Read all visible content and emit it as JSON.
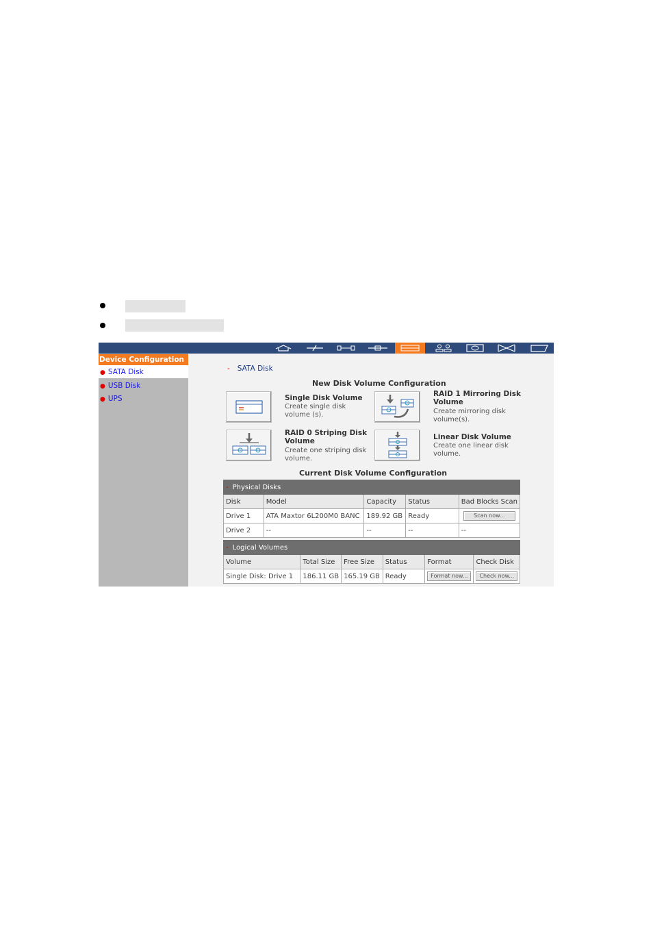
{
  "doc": {
    "bullets": [
      {},
      {}
    ]
  },
  "topbar": {
    "icons": [
      "home-icon",
      "quick-config-icon",
      "system-tools-icon",
      "network-icon",
      "device-config-icon",
      "user-management-icon",
      "network-share-icon",
      "applications-icon",
      "status-icon"
    ],
    "active_index": 4
  },
  "sidebar": {
    "header": "Device Configuration",
    "items": [
      {
        "label": "SATA Disk"
      },
      {
        "label": "USB Disk"
      },
      {
        "label": "UPS"
      }
    ]
  },
  "breadcrumb": {
    "label": "SATA Disk"
  },
  "new_config": {
    "title": "New Disk Volume Configuration",
    "options": [
      {
        "title": "Single Disk Volume",
        "desc": "Create single disk volume (s)."
      },
      {
        "title": "RAID 1 Mirroring Disk Volume",
        "desc": "Create mirroring disk volume(s)."
      },
      {
        "title": "RAID 0 Striping Disk Volume",
        "desc": "Create one striping disk volume."
      },
      {
        "title": "Linear Disk Volume",
        "desc": "Create one linear disk volume."
      }
    ]
  },
  "current_config": {
    "title": "Current Disk Volume Configuration",
    "physical": {
      "caption": "Physical Disks",
      "headers": [
        "Disk",
        "Model",
        "Capacity",
        "Status",
        "Bad Blocks Scan"
      ],
      "rows": [
        {
          "disk": "Drive 1",
          "model": "ATA Maxtor 6L200M0 BANC",
          "capacity": "189.92 GB",
          "status": "Ready",
          "scan": "Scan now..."
        },
        {
          "disk": "Drive 2",
          "model": "--",
          "capacity": "--",
          "status": "--",
          "scan": "--"
        }
      ]
    },
    "logical": {
      "caption": "Logical Volumes",
      "headers": [
        "Volume",
        "Total Size",
        "Free Size",
        "Status",
        "Format",
        "Check Disk"
      ],
      "rows": [
        {
          "volume": "Single Disk: Drive 1",
          "total": "186.11 GB",
          "free": "165.19 GB",
          "status": "Ready",
          "format": "Format now...",
          "check": "Check now..."
        }
      ]
    }
  },
  "colors": {
    "topbar": "#2d4a7a",
    "accent": "#f47a20",
    "sidebar": "#b8b8b8",
    "link": "#1a1aee"
  }
}
